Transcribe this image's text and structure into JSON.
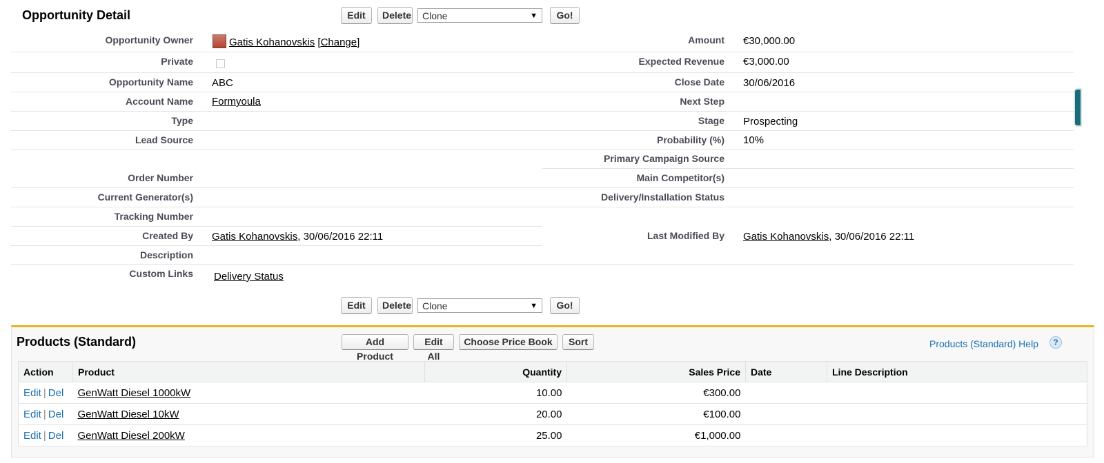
{
  "detail": {
    "title": "Opportunity Detail",
    "buttons": {
      "edit": "Edit",
      "delete": "Delete",
      "clone": "Clone",
      "go": "Go!"
    },
    "left": {
      "owner_label": "Opportunity Owner",
      "owner_value": "Gatis Kohanovskis",
      "owner_change": "[Change]",
      "private_label": "Private",
      "name_label": "Opportunity Name",
      "name_value": "ABC",
      "account_label": "Account Name",
      "account_value": "Formyoula",
      "type_label": "Type",
      "lead_label": "Lead Source",
      "order_label": "Order Number",
      "generator_label": "Current Generator(s)",
      "tracking_label": "Tracking Number",
      "created_label": "Created By",
      "created_user": "Gatis Kohanovskis",
      "created_time": ", 30/06/2016 22:11",
      "description_label": "Description",
      "custom_label": "Custom Links",
      "custom_value": "Delivery Status"
    },
    "right": {
      "amount_label": "Amount",
      "amount_value": "€30,000.00",
      "revenue_label": "Expected Revenue",
      "revenue_value": "€3,000.00",
      "close_label": "Close Date",
      "close_value": "30/06/2016",
      "next_label": "Next Step",
      "stage_label": "Stage",
      "stage_value": "Prospecting",
      "prob_label": "Probability (%)",
      "prob_value": "10%",
      "campaign_label": "Primary Campaign Source",
      "competitor_label": "Main Competitor(s)",
      "delivery_label": "Delivery/Installation Status",
      "modified_label": "Last Modified By",
      "modified_user": "Gatis Kohanovskis",
      "modified_time": ", 30/06/2016 22:11"
    }
  },
  "products": {
    "title": "Products (Standard)",
    "buttons": {
      "add": "Add Product",
      "edit_all": "Edit All",
      "price_book": "Choose Price Book",
      "sort": "Sort"
    },
    "help": "Products (Standard) Help",
    "help_icon": "?",
    "columns": [
      "Action",
      "Product",
      "Quantity",
      "Sales Price",
      "Date",
      "Line Description"
    ],
    "action_edit": "Edit",
    "action_sep": "|",
    "action_del": "Del",
    "rows": [
      {
        "product": "GenWatt Diesel 1000kW",
        "quantity": "10.00",
        "price": "€300.00"
      },
      {
        "product": "GenWatt Diesel 10kW",
        "quantity": "20.00",
        "price": "€100.00"
      },
      {
        "product": "GenWatt Diesel 200kW",
        "quantity": "25.00",
        "price": "€1,000.00"
      }
    ]
  }
}
